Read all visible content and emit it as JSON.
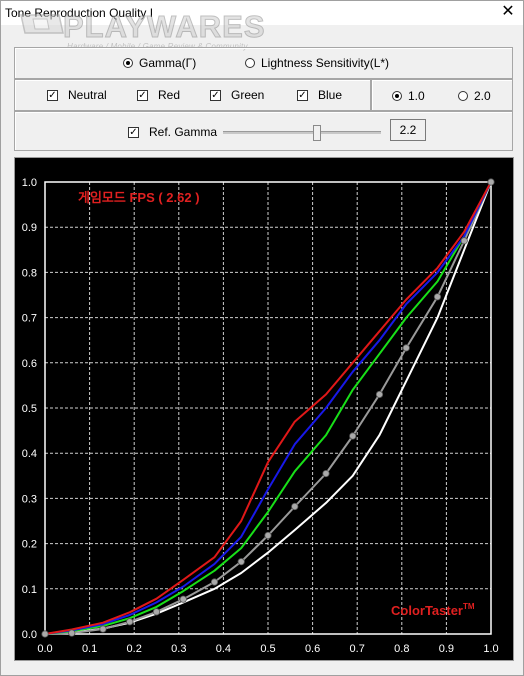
{
  "window": {
    "title": "Tone Reproduction Quality I",
    "close_glyph": "✕"
  },
  "watermark": {
    "brand": "PLAYWARES",
    "tagline": "Hardware / Mobile / Game Review & Community"
  },
  "mode": {
    "gamma_label": "Gamma(Γ)",
    "lightness_label": "Lightness Sensitivity(L*)",
    "selected": "gamma"
  },
  "channels": {
    "neutral_label": "Neutral",
    "red_label": "Red",
    "green_label": "Green",
    "blue_label": "Blue",
    "check_glyph": "✓"
  },
  "scale": {
    "opt1_label": "1.0",
    "opt2_label": "2.0",
    "selected": "1.0"
  },
  "ref_gamma": {
    "label": "Ref. Gamma",
    "value": "2.2",
    "slider_fraction": 0.6,
    "checked": true
  },
  "annotations": {
    "mode_label": "게임모드 FPS ( 2.62 )",
    "brand": "ColorTaster",
    "tm": "TM"
  },
  "colors": {
    "red": "#e01818",
    "green": "#18e018",
    "blue": "#1818e8",
    "neutral": "#ffffff",
    "ref": "#9a9a9a",
    "ref_marker": "#aaaaaa",
    "grid": "#cfcfcf",
    "label_red": "#e02020"
  },
  "chart_data": {
    "type": "line",
    "xlabel": "",
    "ylabel": "",
    "xlim": [
      0,
      1
    ],
    "ylim": [
      0,
      1
    ],
    "x_ticks": [
      "0.0",
      "0.1",
      "0.2",
      "0.3",
      "0.4",
      "0.5",
      "0.6",
      "0.7",
      "0.8",
      "0.9",
      "1.0"
    ],
    "y_ticks": [
      "0.0",
      "0.1",
      "0.2",
      "0.3",
      "0.4",
      "0.5",
      "0.6",
      "0.7",
      "0.8",
      "0.9",
      "1.0"
    ],
    "grid": true,
    "series": [
      {
        "key": "neutral",
        "x": [
          0.0,
          0.06,
          0.13,
          0.19,
          0.25,
          0.31,
          0.38,
          0.44,
          0.5,
          0.56,
          0.63,
          0.69,
          0.75,
          0.81,
          0.88,
          0.94,
          1.0
        ],
        "y": [
          0.0,
          0.003,
          0.012,
          0.025,
          0.045,
          0.07,
          0.1,
          0.135,
          0.18,
          0.23,
          0.29,
          0.35,
          0.44,
          0.56,
          0.7,
          0.85,
          1.0
        ]
      },
      {
        "key": "ref",
        "x": [
          0.0,
          0.06,
          0.13,
          0.19,
          0.25,
          0.31,
          0.38,
          0.44,
          0.5,
          0.56,
          0.63,
          0.69,
          0.75,
          0.81,
          0.88,
          0.94,
          1.0
        ],
        "y": [
          0.0,
          0.002,
          0.011,
          0.027,
          0.049,
          0.077,
          0.115,
          0.16,
          0.218,
          0.282,
          0.355,
          0.438,
          0.53,
          0.633,
          0.746,
          0.87,
          1.0
        ]
      },
      {
        "key": "green",
        "x": [
          0.0,
          0.06,
          0.13,
          0.19,
          0.25,
          0.31,
          0.38,
          0.44,
          0.5,
          0.56,
          0.63,
          0.69,
          0.75,
          0.81,
          0.88,
          0.94,
          1.0
        ],
        "y": [
          0.0,
          0.006,
          0.018,
          0.035,
          0.06,
          0.095,
          0.14,
          0.19,
          0.27,
          0.36,
          0.44,
          0.54,
          0.62,
          0.7,
          0.78,
          0.88,
          1.0
        ]
      },
      {
        "key": "blue",
        "x": [
          0.0,
          0.06,
          0.13,
          0.19,
          0.25,
          0.31,
          0.38,
          0.44,
          0.5,
          0.56,
          0.63,
          0.69,
          0.75,
          0.81,
          0.88,
          0.94,
          1.0
        ],
        "y": [
          0.0,
          0.008,
          0.022,
          0.042,
          0.07,
          0.105,
          0.155,
          0.215,
          0.32,
          0.42,
          0.5,
          0.58,
          0.65,
          0.73,
          0.8,
          0.88,
          1.0
        ]
      },
      {
        "key": "red",
        "x": [
          0.0,
          0.06,
          0.13,
          0.19,
          0.25,
          0.31,
          0.38,
          0.44,
          0.5,
          0.56,
          0.63,
          0.69,
          0.75,
          0.81,
          0.88,
          0.94,
          1.0
        ],
        "y": [
          0.0,
          0.01,
          0.025,
          0.048,
          0.078,
          0.12,
          0.17,
          0.25,
          0.38,
          0.47,
          0.53,
          0.6,
          0.67,
          0.74,
          0.81,
          0.89,
          1.0
        ]
      }
    ]
  }
}
